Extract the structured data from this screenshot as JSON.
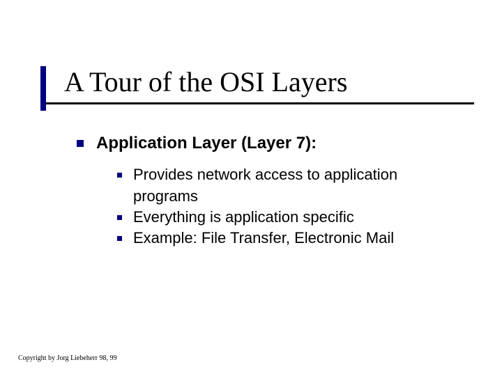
{
  "title": "A Tour of the OSI Layers",
  "lvl1": {
    "heading": "Application Layer (Layer 7):"
  },
  "lvl2": {
    "items": [
      {
        "text": "Provides network access to application programs"
      },
      {
        "text": "Everything is application specific"
      },
      {
        "text": "Example: File Transfer, Electronic Mail"
      }
    ]
  },
  "footer": "Copyright by Jorg Liebeherr 98, 99"
}
